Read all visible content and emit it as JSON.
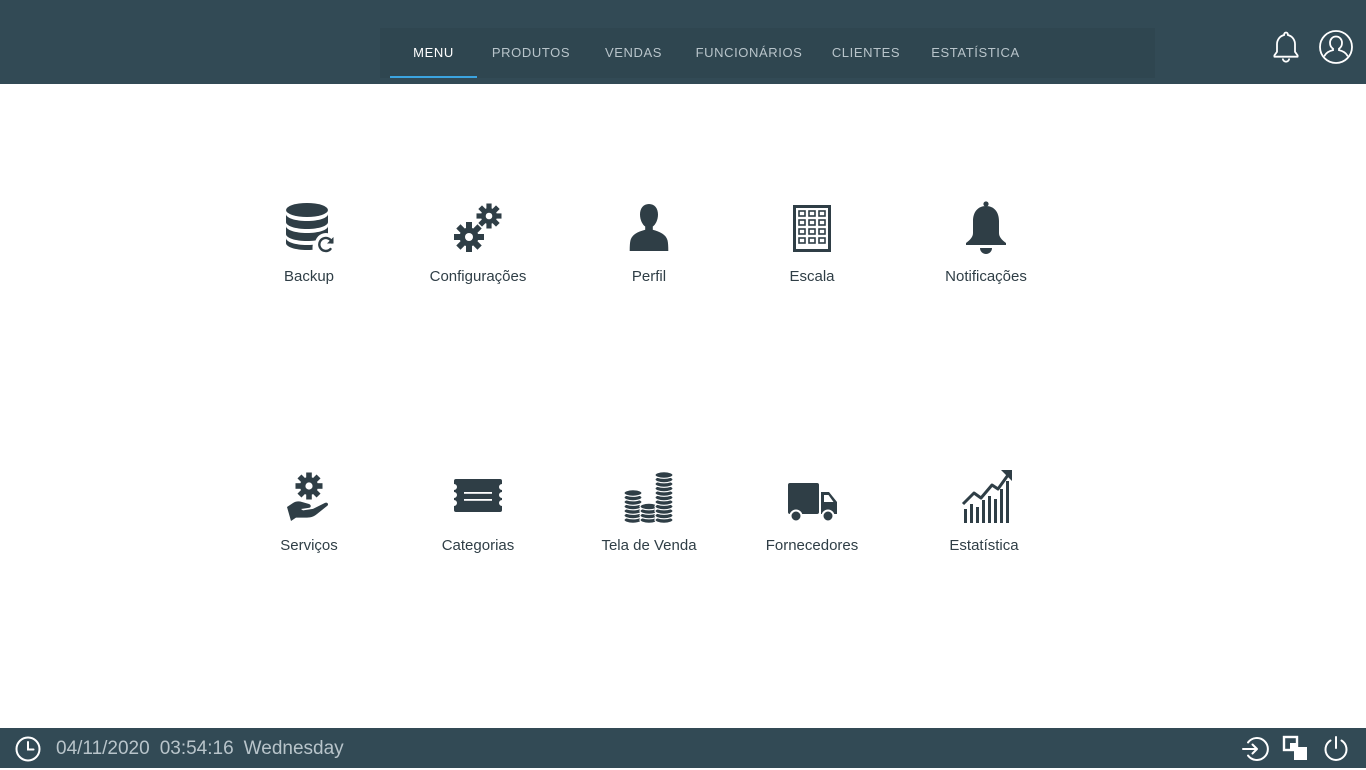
{
  "nav": {
    "tabs": [
      {
        "label": "MENU",
        "active": true
      },
      {
        "label": "PRODUTOS"
      },
      {
        "label": "VENDAS"
      },
      {
        "label": "FUNCIONÁRIOS"
      },
      {
        "label": "CLIENTES"
      },
      {
        "label": "ESTATÍSTICA"
      }
    ],
    "icons": [
      "bell-icon",
      "user-icon"
    ]
  },
  "menu": {
    "row1": [
      {
        "label": "Backup",
        "icon": "database-refresh-icon"
      },
      {
        "label": "Configurações",
        "icon": "gears-icon"
      },
      {
        "label": "Perfil",
        "icon": "person-icon"
      },
      {
        "label": "Escala",
        "icon": "building-icon"
      },
      {
        "label": "Notificações",
        "icon": "bell-icon"
      }
    ],
    "row2": [
      {
        "label": "Serviços",
        "icon": "gear-hand-icon"
      },
      {
        "label": "Categorias",
        "icon": "card-icon"
      },
      {
        "label": "Tela de Venda",
        "icon": "coins-icon"
      },
      {
        "label": "Fornecedores",
        "icon": "truck-icon"
      },
      {
        "label": "Estatística",
        "icon": "growth-chart-icon"
      }
    ]
  },
  "status": {
    "date": "04/11/2020",
    "time": "03:54:16",
    "weekday": "Wednesday"
  },
  "colors": {
    "bar": "#324a55",
    "accent": "#3ba4e0",
    "icon": "#2f3e46"
  }
}
